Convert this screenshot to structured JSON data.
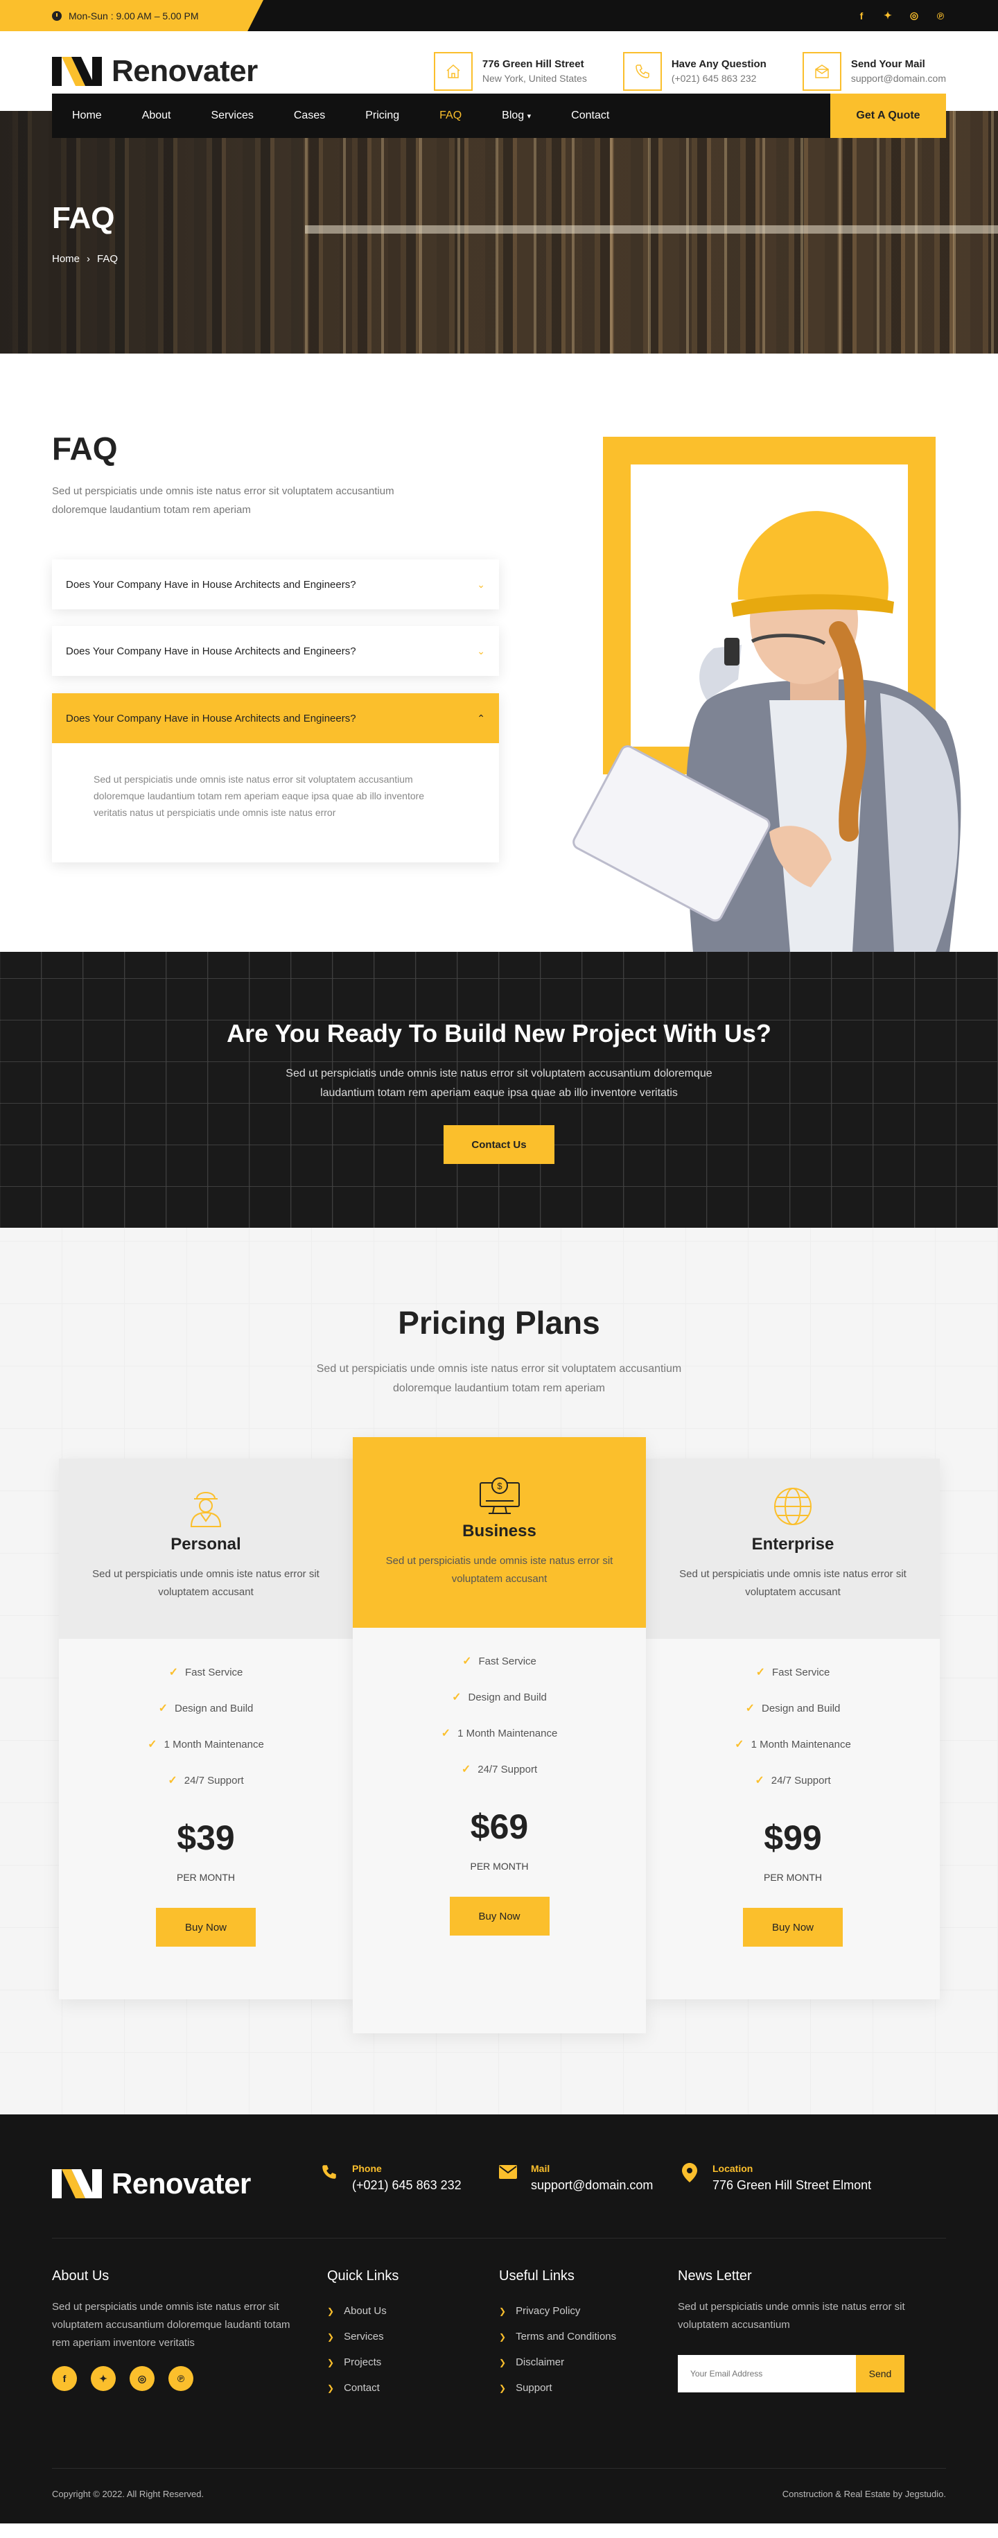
{
  "topbar": {
    "hours": "Mon-Sun : 9.00 AM – 5.00 PM",
    "social": [
      {
        "icon": "facebook-icon",
        "glyph": "f"
      },
      {
        "icon": "twitter-icon",
        "glyph": "✦"
      },
      {
        "icon": "instagram-icon",
        "glyph": "◎"
      },
      {
        "icon": "pinterest-icon",
        "glyph": "℗"
      }
    ]
  },
  "brand": {
    "name": "Renovater",
    "accent": "#fbbf2c",
    "dark": "#111111"
  },
  "header": {
    "address_title": "776 Green Hill Street",
    "address_sub": "New York, United States",
    "question_title": "Have Any Question",
    "question_sub": "(+021) 645 863 232",
    "mail_title": "Send Your Mail",
    "mail_sub": "support@domain.com"
  },
  "nav": {
    "items": [
      "Home",
      "About",
      "Services",
      "Cases",
      "Pricing",
      "FAQ",
      "Blog",
      "Contact"
    ],
    "active": "FAQ",
    "quote_label": "Get A Quote"
  },
  "hero": {
    "title": "FAQ",
    "crumb_home": "Home",
    "crumb_sep": "›",
    "crumb_current": "FAQ"
  },
  "faq": {
    "title": "FAQ",
    "intro": "Sed ut perspiciatis unde omnis iste natus error sit voluptatem accusantium doloremque laudantium totam rem aperiam",
    "items": [
      {
        "question": "Does Your Company Have in House Architects and Engineers?",
        "open": false
      },
      {
        "question": "Does Your Company Have in House Architects and Engineers?",
        "open": false
      },
      {
        "question": "Does Your Company Have in House Architects and Engineers?",
        "open": true,
        "answer": "Sed ut perspiciatis unde omnis iste natus error sit voluptatem accusantium doloremque laudantium totam rem aperiam eaque ipsa quae ab illo inventore veritatis natus ut perspiciatis unde omnis iste natus error"
      }
    ]
  },
  "cta": {
    "title": "Are You Ready To Build New Project With Us?",
    "text": "Sed ut perspiciatis unde omnis iste natus error sit voluptatem accusantium doloremque laudantium totam rem aperiam eaque ipsa quae ab illo inventore veritatis",
    "button": "Contact Us"
  },
  "pricing": {
    "title": "Pricing Plans",
    "text": "Sed ut perspiciatis unde omnis iste natus error sit voluptatem accusantium doloremque laudantium totam rem aperiam",
    "plans": [
      {
        "name": "Personal",
        "icon": "worker-icon",
        "desc": "Sed ut perspiciatis unde omnis iste natus error sit voluptatem accusant",
        "features": [
          "Fast Service",
          "Design and Build",
          "1 Month Maintenance",
          "24/7 Support"
        ],
        "price": "$39",
        "period": "PER MONTH",
        "button": "Buy Now",
        "featured": false
      },
      {
        "name": "Business",
        "icon": "monitor-dollar-icon",
        "desc": "Sed ut perspiciatis unde omnis iste natus error sit voluptatem accusant",
        "features": [
          "Fast Service",
          "Design and Build",
          "1 Month Maintenance",
          "24/7 Support"
        ],
        "price": "$69",
        "period": "PER MONTH",
        "button": "Buy Now",
        "featured": true
      },
      {
        "name": "Enterprise",
        "icon": "globe-icon",
        "desc": "Sed ut perspiciatis unde omnis iste natus error sit voluptatem accusant",
        "features": [
          "Fast Service",
          "Design and Build",
          "1 Month Maintenance",
          "24/7 Support"
        ],
        "price": "$99",
        "period": "PER MONTH",
        "button": "Buy Now",
        "featured": false
      }
    ]
  },
  "footer": {
    "phone_label": "Phone",
    "phone_value": "(+021) 645 863 232",
    "mail_label": "Mail",
    "mail_value": "support@domain.com",
    "location_label": "Location",
    "location_value": "776 Green Hill Street Elmont",
    "about_title": "About Us",
    "about_text": "Sed ut perspiciatis unde omnis iste natus error sit voluptatem accusantium doloremque laudanti totam rem aperiam inventore veritatis",
    "quick_title": "Quick Links",
    "quick_links": [
      "About Us",
      "Services",
      "Projects",
      "Contact"
    ],
    "useful_title": "Useful Links",
    "useful_links": [
      "Privacy Policy",
      "Terms and Conditions",
      "Disclaimer",
      "Support"
    ],
    "news_title": "News Letter",
    "news_text": "Sed ut perspiciatis unde omnis iste natus error sit voluptatem accusantium",
    "email_placeholder": "Your Email Address",
    "send_label": "Send",
    "copyright": "Copyright © 2022. All Right Reserved.",
    "credit": "Construction & Real Estate by Jegstudio."
  }
}
